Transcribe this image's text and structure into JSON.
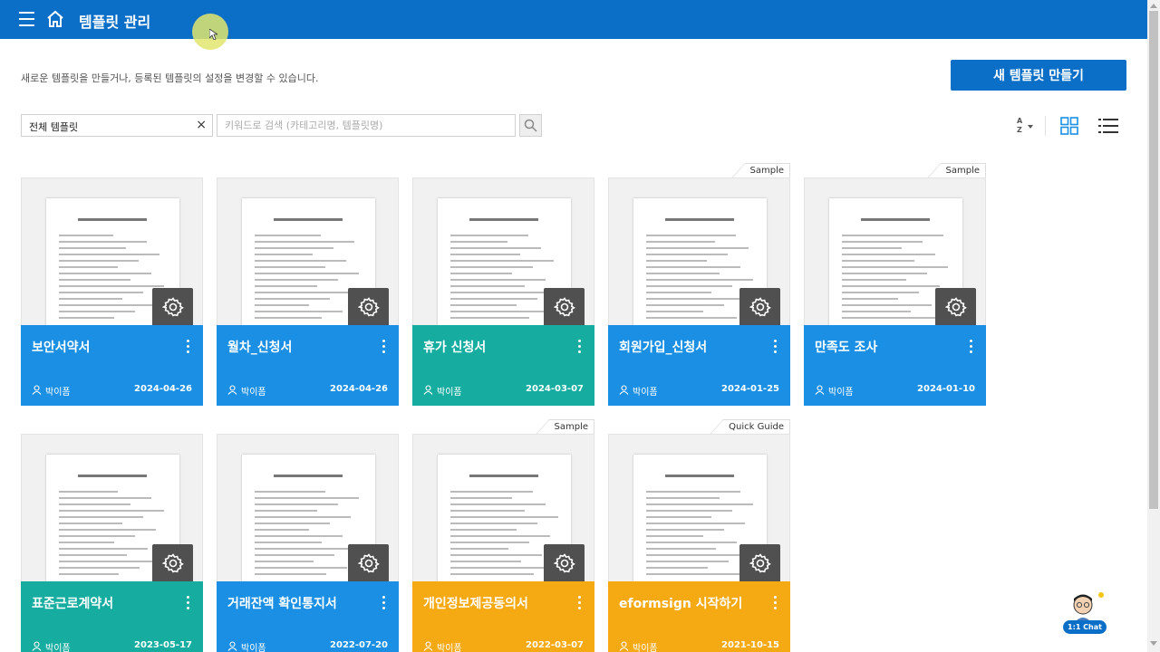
{
  "header": {
    "title": "템플릿 관리"
  },
  "description": "새로운 템플릿을 만들거나, 등록된 템플릿의 설정을 변경할 수 있습니다.",
  "new_button_label": "새 템플릿 만들기",
  "filter": {
    "value": "전체 템플릿",
    "clear_symbol": "×"
  },
  "search": {
    "placeholder": "키워드로 검색 (카테고리명, 템플릿명)"
  },
  "colors": {
    "brand": "#0b6fc7",
    "blue": "#1a8fe3",
    "teal": "#16ada0",
    "orange": "#f5a912",
    "gear_bg": "#505050"
  },
  "templates": [
    {
      "name": "보안서약서",
      "author": "박이폼",
      "date": "2024-04-26",
      "color": "blue",
      "tab": ""
    },
    {
      "name": "월차_신청서",
      "author": "박이폼",
      "date": "2024-04-26",
      "color": "blue",
      "tab": ""
    },
    {
      "name": "휴가 신청서",
      "author": "박이폼",
      "date": "2024-03-07",
      "color": "teal",
      "tab": ""
    },
    {
      "name": "회원가입_신청서",
      "author": "박이폼",
      "date": "2024-01-25",
      "color": "blue",
      "tab": "Sample"
    },
    {
      "name": "만족도 조사",
      "author": "박이폼",
      "date": "2024-01-10",
      "color": "blue",
      "tab": "Sample"
    },
    {
      "name": "표준근로계약서",
      "author": "박이폼",
      "date": "2023-05-17",
      "color": "teal",
      "tab": ""
    },
    {
      "name": "거래잔액 확인통지서",
      "author": "박이폼",
      "date": "2022-07-20",
      "color": "blue",
      "tab": ""
    },
    {
      "name": "개인정보제공동의서",
      "author": "박이폼",
      "date": "2022-03-07",
      "color": "orange",
      "tab": "Sample"
    },
    {
      "name": "eformsign 시작하기",
      "author": "박이폼",
      "date": "2021-10-15",
      "color": "orange",
      "tab": "Quick Guide"
    }
  ],
  "chat": {
    "label": "1:1 Chat"
  }
}
